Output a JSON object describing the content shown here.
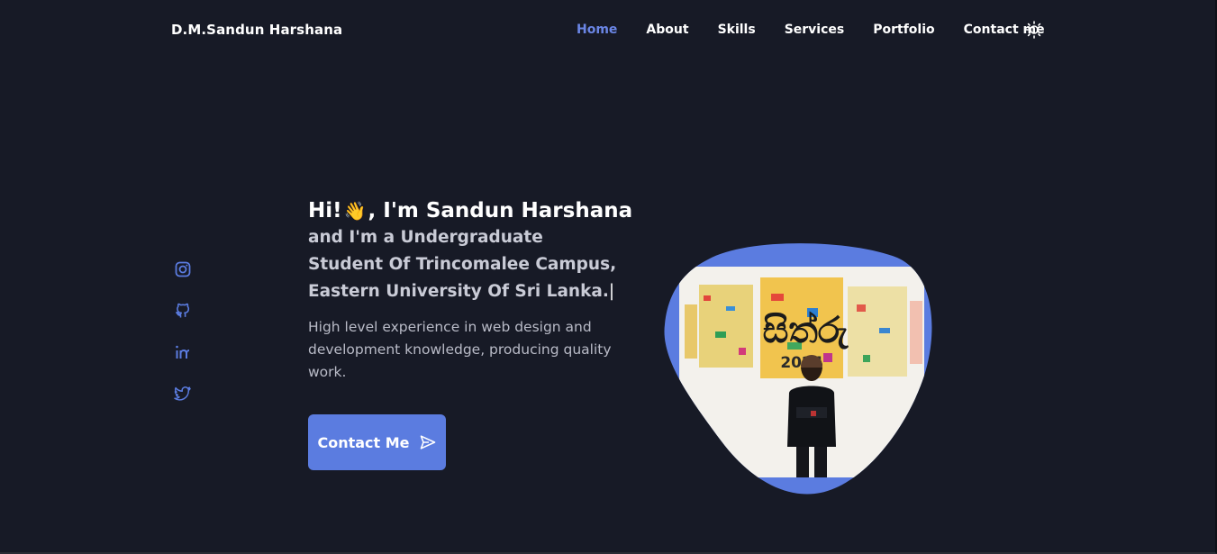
{
  "header": {
    "brand": "D.M.Sandun Harshana",
    "nav": [
      {
        "label": "Home",
        "active": true
      },
      {
        "label": "About",
        "active": false
      },
      {
        "label": "Skills",
        "active": false
      },
      {
        "label": "Services",
        "active": false
      },
      {
        "label": "Portfolio",
        "active": false
      },
      {
        "label": "Contact me",
        "active": false
      }
    ],
    "theme_icon": "sun-icon"
  },
  "socials": [
    {
      "icon": "instagram-icon"
    },
    {
      "icon": "github-icon"
    },
    {
      "icon": "linkedin-icon"
    },
    {
      "icon": "twitter-icon"
    }
  ],
  "hero": {
    "greeting_prefix": "Hi!",
    "wave": "👋",
    "greeting_suffix": ", I'm Sandun Harshana",
    "subtitle": "and I'm a Undergraduate Student Of Trincomalee Campus, Eastern University Of Sri Lanka.",
    "caret": "|",
    "description": "High level experience in web design and development knowledge, producing quality work.",
    "cta_label": "Contact Me",
    "cta_icon": "send-icon",
    "image_caption_sinhala": "සිත්රු",
    "image_caption_year": "2024"
  },
  "colors": {
    "background": "#171a26",
    "accent": "#5b7ce0",
    "nav_active": "#6b86e6",
    "text": "#ffffff",
    "muted_text": "#b9bbc7"
  }
}
